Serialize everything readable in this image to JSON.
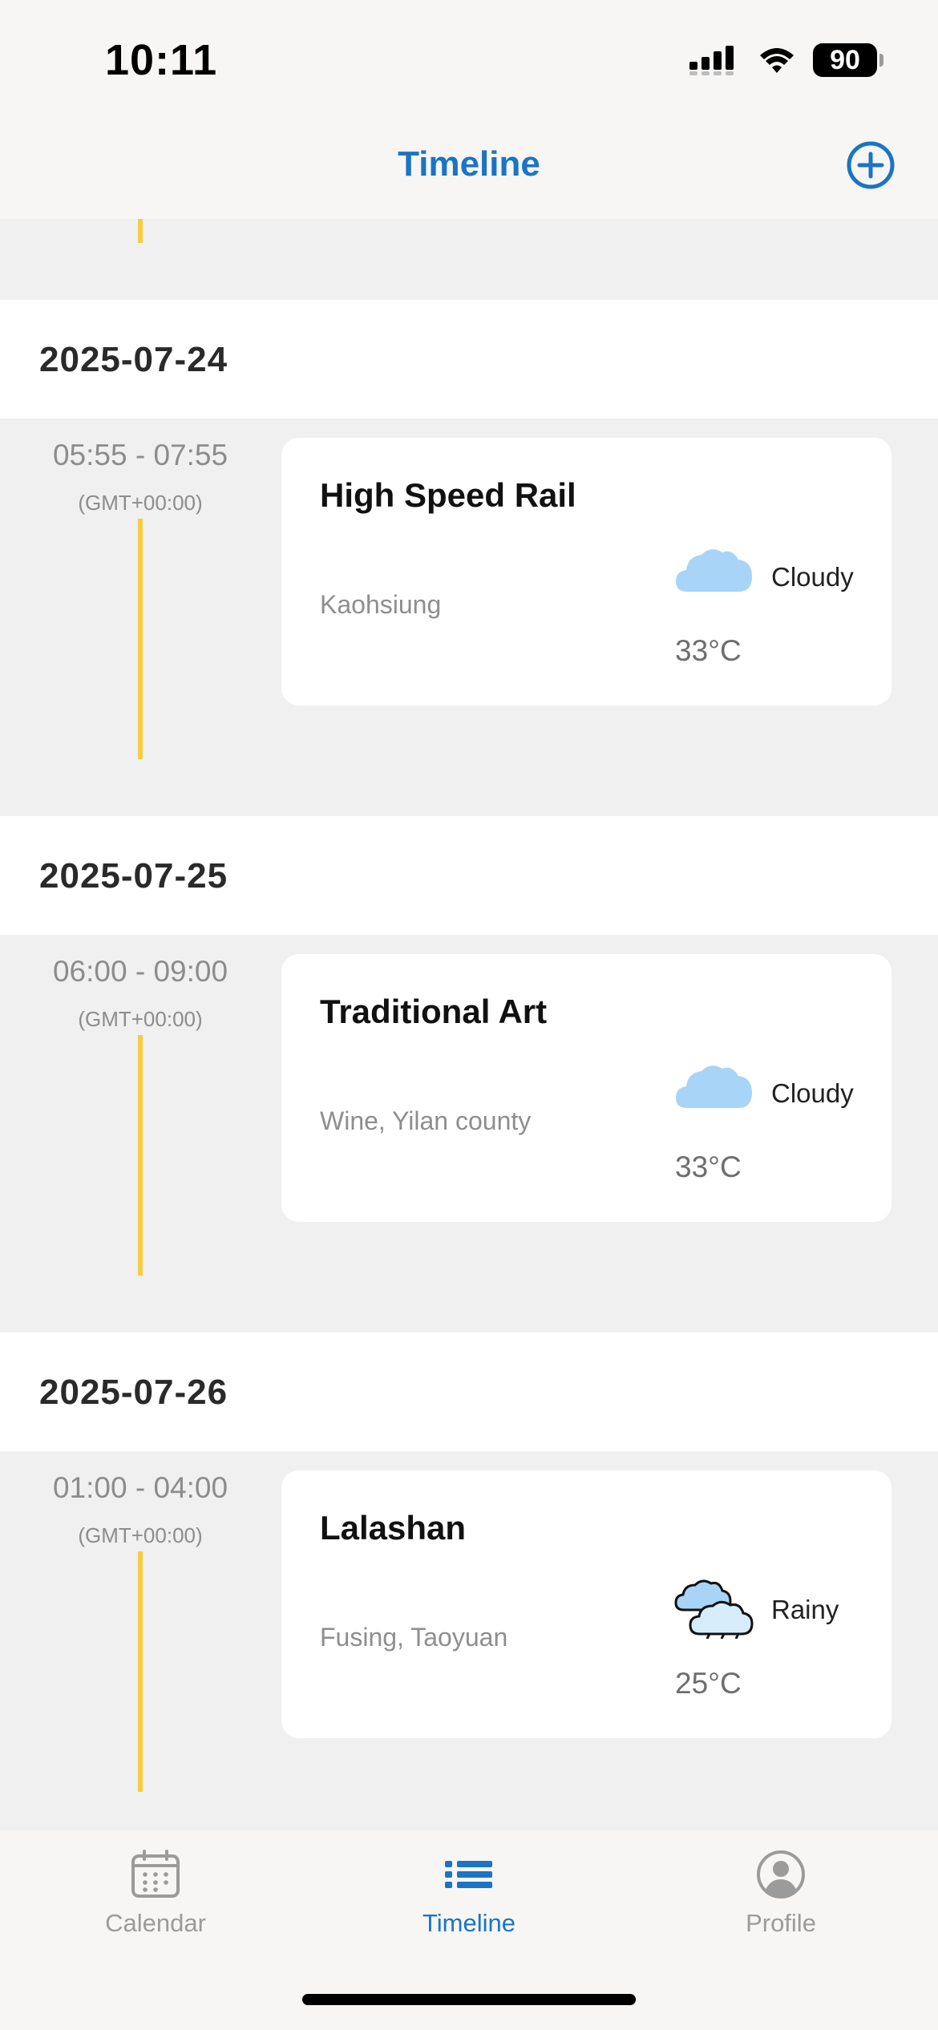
{
  "status": {
    "time": "10:11",
    "battery": "90"
  },
  "nav": {
    "title": "Timeline"
  },
  "days": [
    {
      "date": "2025-07-24",
      "time_range": "05:55 - 07:55",
      "timezone": "(GMT+00:00)",
      "event": {
        "title": "High Speed Rail",
        "location": "Kaohsiung",
        "weather": "Cloudy",
        "temperature": "33°C",
        "weather_icon": "cloud-icon"
      }
    },
    {
      "date": "2025-07-25",
      "time_range": "06:00 - 09:00",
      "timezone": "(GMT+00:00)",
      "event": {
        "title": "Traditional Art",
        "location": "Wine, Yilan county",
        "weather": "Cloudy",
        "temperature": "33°C",
        "weather_icon": "cloud-icon"
      }
    },
    {
      "date": "2025-07-26",
      "time_range": "01:00 - 04:00",
      "timezone": "(GMT+00:00)",
      "event": {
        "title": "Lalashan",
        "location": "Fusing, Taoyuan",
        "weather": "Rainy",
        "temperature": "25°C",
        "weather_icon": "rain-clouds-icon"
      }
    }
  ],
  "tabs": [
    {
      "label": "Calendar",
      "icon": "calendar-icon",
      "active": false
    },
    {
      "label": "Timeline",
      "icon": "list-icon",
      "active": true
    },
    {
      "label": "Profile",
      "icon": "profile-icon",
      "active": false
    }
  ],
  "colors": {
    "accent": "#1b74c5",
    "timeline_line": "#f5cd43",
    "inactive": "#9b9b9b"
  }
}
